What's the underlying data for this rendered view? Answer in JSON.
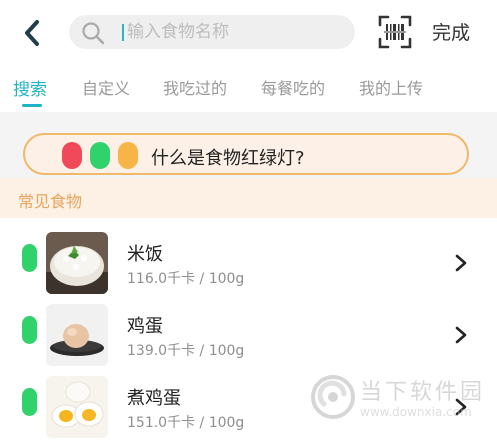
{
  "header": {
    "back_icon": "chevron-left-icon",
    "search": {
      "placeholder": "输入食物名称",
      "value": "",
      "icon": "search-icon"
    },
    "scan_icon": "barcode-scan-icon",
    "done_label": "完成"
  },
  "tabs": [
    {
      "label": "搜索",
      "active": true
    },
    {
      "label": "自定义",
      "active": false
    },
    {
      "label": "我吃过的",
      "active": false
    },
    {
      "label": "每餐吃的",
      "active": false
    },
    {
      "label": "我的上传",
      "active": false
    }
  ],
  "banner": {
    "text": "什么是食物红绿灯?",
    "lights": [
      "#f04a5a",
      "#2fd26b",
      "#f7b547"
    ]
  },
  "section": {
    "title": "常见食物"
  },
  "foods": [
    {
      "name": "米饭",
      "calories": "116.0千卡 / 100g",
      "light": "#2fd26b",
      "image": "rice-bowl"
    },
    {
      "name": "鸡蛋",
      "calories": "139.0千卡 / 100g",
      "light": "#2fd26b",
      "image": "egg-on-plate"
    },
    {
      "name": "煮鸡蛋",
      "calories": "151.0千卡 / 100g",
      "light": "#2fd26b",
      "image": "boiled-egg"
    }
  ],
  "watermark": {
    "title": "当下软件园",
    "url": "www.downxia.com"
  },
  "colors": {
    "accent": "#1fb3c6",
    "section_text": "#e8a45c",
    "banner_border": "#f0b96a"
  }
}
